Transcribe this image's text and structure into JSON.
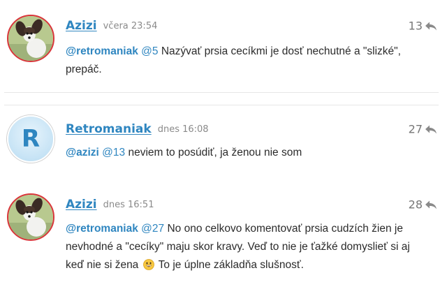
{
  "comments": [
    {
      "author": "Azizi",
      "time": "včera 23:54",
      "votes": "13",
      "avatar": "dog-avatar",
      "mention": "@retromaniak",
      "ref": "@5",
      "lines": [
        "Nazývať prsia cecíkmi je dosť nechutné a \"slizké\",",
        "prepáč."
      ]
    },
    {
      "author": "Retromaniak",
      "time": "dnes 16:08",
      "votes": "27",
      "avatar": "letter-avatar",
      "avatar_letter": "R",
      "mention": "@azizi",
      "ref": "@13",
      "lines": [
        "neviem to posúdiť, ja ženou nie som"
      ]
    },
    {
      "author": "Azizi",
      "time": "dnes 16:51",
      "votes": "28",
      "avatar": "dog-avatar",
      "mention": "@retromaniak",
      "ref": "@27",
      "lines": [
        "No ono celkovo komentovať prsia cudzích žien je",
        "nevhodné a \"cecíky\" maju skor kravy. Veď to nie je ťažké domyslieť si aj",
        "keď nie si žena",
        "To je úplne základňa slušnosť."
      ],
      "emoji": "grinning-face-emoji"
    }
  ],
  "colors": {
    "link": "#2f86c0",
    "avatar_border": "#d9343a",
    "meta": "#8a8a8a",
    "divider": "#e6e6e6"
  },
  "icons": {
    "reply": "reply-arrow-icon"
  }
}
